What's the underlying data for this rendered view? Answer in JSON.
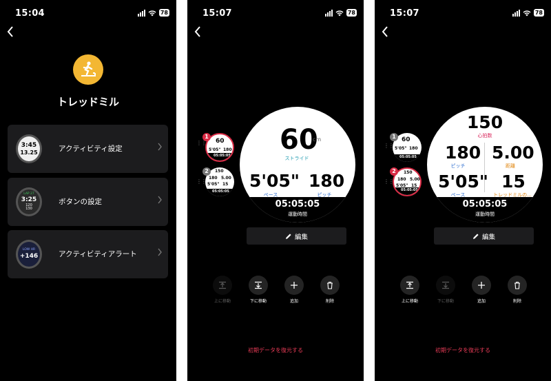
{
  "screen1": {
    "time": "15:04",
    "battery": "78",
    "activity_title": "トレッドミル",
    "cards": [
      {
        "label": "アクティビティ設定",
        "preview": [
          "3:45",
          "13.25"
        ]
      },
      {
        "label": "ボタンの設定",
        "preview": [
          "LAP 27",
          "3:25",
          "120",
          "130"
        ]
      },
      {
        "label": "アクティビティアラート",
        "preview": [
          "LOW HR",
          "+146"
        ]
      }
    ],
    "icon": "treadmill-icon"
  },
  "screen2": {
    "time": "15:07",
    "battery": "78",
    "main_face": {
      "value_top": "60",
      "unit_top": "cm",
      "label_top": "ストライド",
      "value_left": "5'05\"",
      "label_left": "ペース",
      "value_right": "180",
      "label_right": "ピッチ",
      "bottom_value": "05:05:05",
      "bottom_label": "運動時間"
    },
    "thumbs": [
      {
        "index": "1",
        "lines": [
          "60",
          "5'05\"",
          "180",
          "05:05:05"
        ]
      },
      {
        "index": "2",
        "lines": [
          "150",
          "180",
          "5.00",
          "5'05\"",
          "15",
          "05:05:05"
        ]
      }
    ],
    "edit_label": "編集",
    "actions": [
      {
        "label": "上に移動",
        "icon": "move-up-icon"
      },
      {
        "label": "下に移動",
        "icon": "move-down-icon"
      },
      {
        "label": "追加",
        "icon": "plus-icon"
      },
      {
        "label": "削除",
        "icon": "trash-icon"
      }
    ],
    "reset_label": "初期データを復元する"
  },
  "screen3": {
    "time": "15:07",
    "battery": "78",
    "main_face": {
      "value_top": "150",
      "label_top": "心拍数",
      "value_ml": "180",
      "label_ml": "ピッチ",
      "value_mr": "5.00",
      "label_mr": "距離",
      "value_bl": "5'05\"",
      "label_bl": "ペース",
      "value_br": "15",
      "label_br": "トレッドミルの...",
      "bottom_value": "05:05:05",
      "bottom_label": "運動時間"
    },
    "thumbs": [
      {
        "index": "1",
        "lines": [
          "60",
          "5'05\"",
          "180",
          "05:05:05"
        ]
      },
      {
        "index": "2",
        "lines": [
          "150",
          "180",
          "5.00",
          "5'05\"",
          "15",
          "05:05:05"
        ]
      }
    ],
    "edit_label": "編集",
    "actions": [
      {
        "label": "上に移動",
        "icon": "move-up-icon"
      },
      {
        "label": "下に移動",
        "icon": "move-down-icon"
      },
      {
        "label": "追加",
        "icon": "plus-icon"
      },
      {
        "label": "削除",
        "icon": "trash-icon"
      }
    ],
    "reset_label": "初期データを復元する"
  },
  "colors": {
    "accent_red": "#e43a55",
    "selected_border": "#d92b45",
    "icon_yellow": "#f3b733",
    "label_blue": "#2f6fd0",
    "label_pink": "#d9265b",
    "label_orange": "#e0840c",
    "label_teal": "#1f9bb0"
  }
}
